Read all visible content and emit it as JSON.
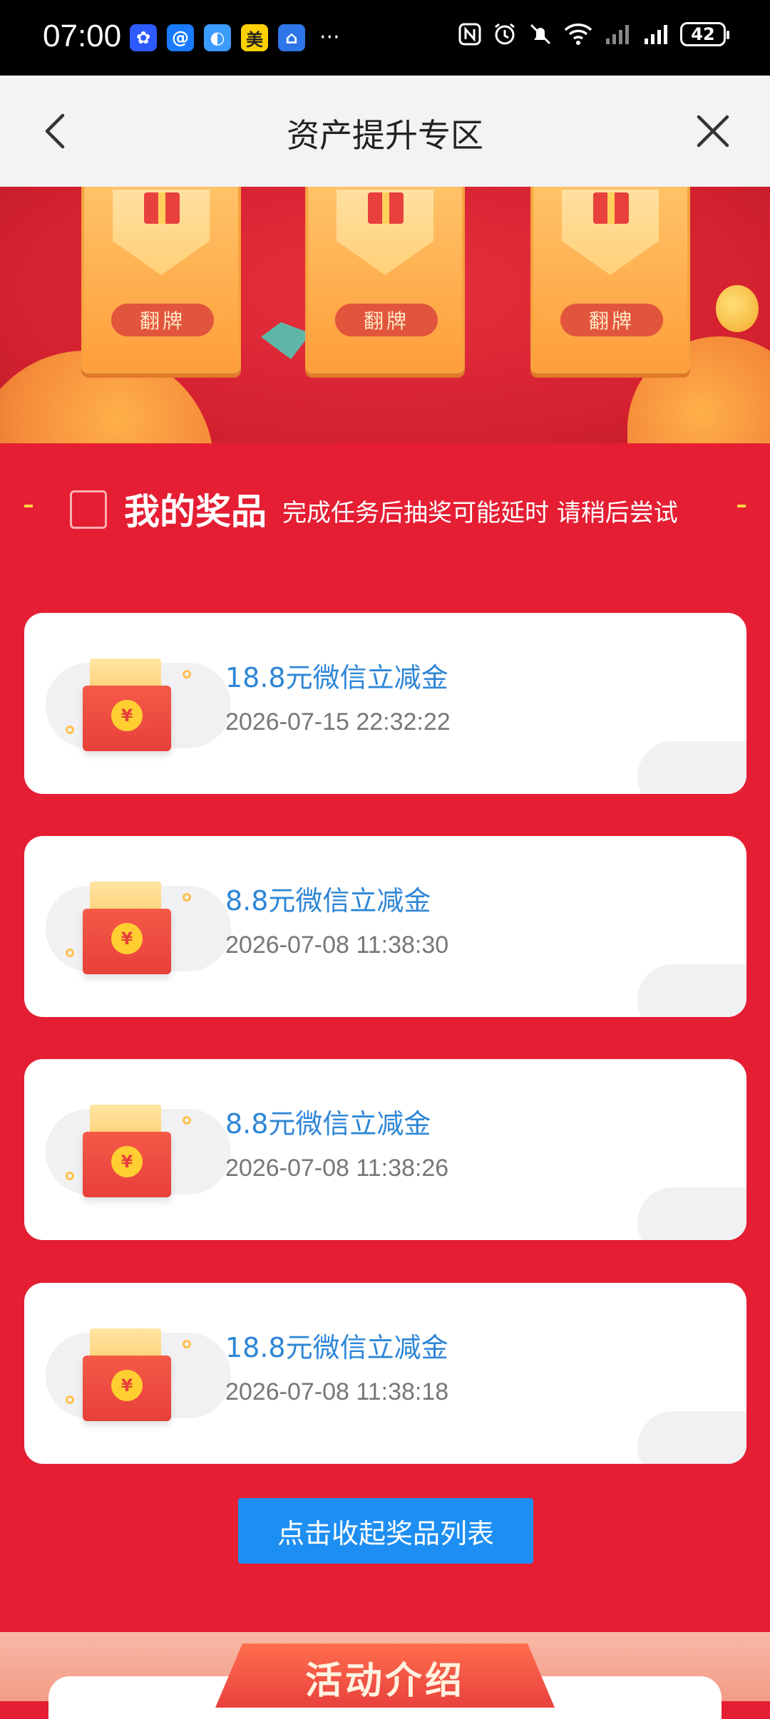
{
  "status_bar": {
    "time": "07:00",
    "apps": [
      {
        "icon": "app-blue-icon",
        "color": "#2E5BFF",
        "glyph": "✿"
      },
      {
        "icon": "app-cyan-icon",
        "color": "#1A7BFF",
        "glyph": "@"
      },
      {
        "icon": "app-photo-icon",
        "color": "#3C9BFF",
        "glyph": "◐"
      },
      {
        "icon": "app-meituan-icon",
        "color": "#FFD100",
        "glyph": "美"
      },
      {
        "icon": "app-bank-icon",
        "color": "#2E76E8",
        "glyph": "⌂"
      }
    ],
    "more": "···",
    "battery": "42"
  },
  "title_bar": {
    "title": "资产提升专区"
  },
  "banner": {
    "flip_label": "翻牌"
  },
  "prizes_section": {
    "title": "我的奖品",
    "note": "完成任务后抽奖可能延时 请稍后尝试",
    "items": [
      {
        "name": "18.8元微信立减金",
        "time": "2026-07-15 22:32:22"
      },
      {
        "name": "8.8元微信立减金",
        "time": "2026-07-08 11:38:30"
      },
      {
        "name": "8.8元微信立减金",
        "time": "2026-07-08 11:38:26"
      },
      {
        "name": "18.8元微信立减金",
        "time": "2026-07-08 11:38:18"
      }
    ],
    "yuan_symbol": "¥",
    "collapse_label": "点击收起奖品列表"
  },
  "intro": {
    "title": "活动介绍"
  },
  "colors": {
    "page_red": "#E51E33",
    "prize_blue": "#2E86D6",
    "button_blue": "#1E8FF2"
  }
}
